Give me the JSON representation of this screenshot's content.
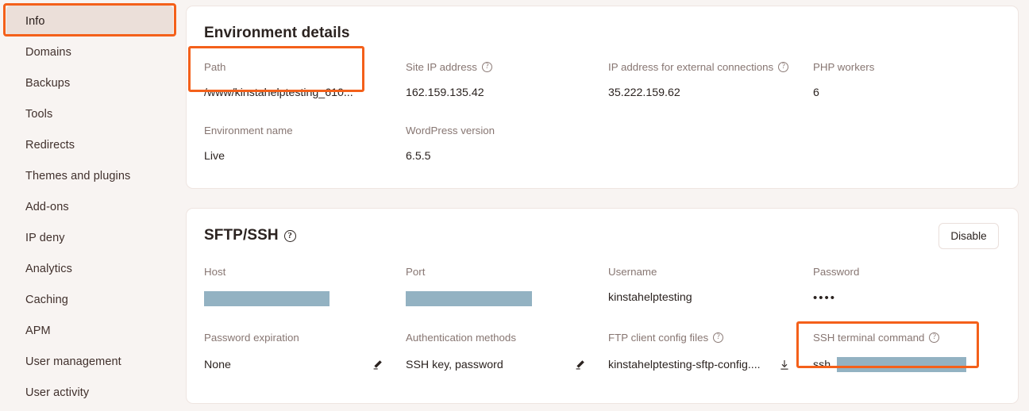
{
  "sidebar": {
    "items": [
      {
        "label": "Info",
        "active": true
      },
      {
        "label": "Domains",
        "active": false
      },
      {
        "label": "Backups",
        "active": false
      },
      {
        "label": "Tools",
        "active": false
      },
      {
        "label": "Redirects",
        "active": false
      },
      {
        "label": "Themes and plugins",
        "active": false
      },
      {
        "label": "Add-ons",
        "active": false
      },
      {
        "label": "IP deny",
        "active": false
      },
      {
        "label": "Analytics",
        "active": false
      },
      {
        "label": "Caching",
        "active": false
      },
      {
        "label": "APM",
        "active": false
      },
      {
        "label": "User management",
        "active": false
      },
      {
        "label": "User activity",
        "active": false
      }
    ]
  },
  "environment_details": {
    "title": "Environment details",
    "path": {
      "label": "Path",
      "value": "/www/kinstahelptesting_610..."
    },
    "site_ip": {
      "label": "Site IP address",
      "value": "162.159.135.42",
      "help_icon": "help-circle-icon"
    },
    "external_ip": {
      "label": "IP address for external connections",
      "value": "35.222.159.62",
      "help_icon": "help-circle-icon"
    },
    "php_workers": {
      "label": "PHP workers",
      "value": "6"
    },
    "environment_name": {
      "label": "Environment name",
      "value": "Live"
    },
    "wordpress_version": {
      "label": "WordPress version",
      "value": "6.5.5"
    }
  },
  "sftp_ssh": {
    "title": "SFTP/SSH",
    "title_help_icon": "help-circle-icon",
    "disable_button": "Disable",
    "host": {
      "label": "Host",
      "value": "",
      "redacted": true
    },
    "port": {
      "label": "Port",
      "value": "",
      "redacted": true
    },
    "username": {
      "label": "Username",
      "value": "kinstahelptesting"
    },
    "password": {
      "label": "Password",
      "value": "••••"
    },
    "password_expiration": {
      "label": "Password expiration",
      "value": "None",
      "action_icon": "pencil-icon"
    },
    "authentication_methods": {
      "label": "Authentication methods",
      "value": "SSH key, password",
      "action_icon": "pencil-icon"
    },
    "ftp_client_config": {
      "label": "FTP client config files",
      "value": "kinstahelptesting-sftp-config....",
      "action_icon": "download-icon",
      "help_icon": "help-circle-icon"
    },
    "ssh_terminal_command": {
      "label": "SSH terminal command",
      "value": "ssh",
      "redacted": true,
      "help_icon": "help-circle-icon"
    }
  },
  "annotations": {
    "highlight_color": "#f4601a",
    "boxes": [
      "info-nav-item",
      "path-field",
      "ssh-terminal-command-field"
    ]
  },
  "colors": {
    "page_background": "#f8f4f2",
    "card_background": "#ffffff",
    "active_nav": "#ebdfd9",
    "redaction": "#93b2c2",
    "highlight": "#f4601a"
  }
}
